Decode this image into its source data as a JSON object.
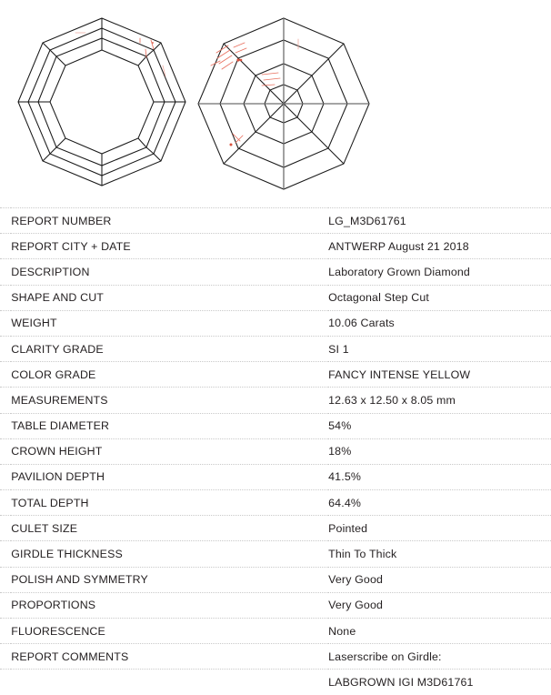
{
  "document": {
    "type": "laboratory-grown-diamond-report",
    "title": "Diamond Grading Report"
  },
  "diagrams": {
    "crown": {
      "name": "crown-view",
      "caption": "",
      "shape": "octagonal step cut crown",
      "ring_count": 4
    },
    "pavilion": {
      "name": "pavilion-view",
      "caption": "",
      "shape": "octagonal step cut pavilion",
      "ring_count": 4,
      "has_culet": true
    },
    "inclusion_color": "#d9503c",
    "facet_color": "#1a1a1a",
    "axis_color": "#6f6f6f"
  },
  "table": {
    "rows": [
      {
        "label": "REPORT NUMBER",
        "value": "LG_M3D61761"
      },
      {
        "label": "REPORT CITY + DATE",
        "value": "ANTWERP August 21 2018"
      },
      {
        "label": "DESCRIPTION",
        "value": "Laboratory Grown Diamond"
      },
      {
        "label": "SHAPE AND CUT",
        "value": "Octagonal Step Cut"
      },
      {
        "label": "WEIGHT",
        "value": "10.06 Carats"
      },
      {
        "label": "CLARITY GRADE",
        "value": "SI 1"
      },
      {
        "label": "COLOR GRADE",
        "value": "FANCY INTENSE YELLOW"
      },
      {
        "label": "MEASUREMENTS",
        "value": "12.63 x 12.50 x 8.05 mm"
      },
      {
        "label": "TABLE DIAMETER",
        "value": "54%"
      },
      {
        "label": "CROWN HEIGHT",
        "value": "18%"
      },
      {
        "label": "PAVILION DEPTH",
        "value": "41.5%"
      },
      {
        "label": "TOTAL DEPTH",
        "value": "64.4%"
      },
      {
        "label": "CULET SIZE",
        "value": "Pointed"
      },
      {
        "label": "GIRDLE THICKNESS",
        "value": "Thin To Thick"
      },
      {
        "label": "POLISH AND SYMMETRY",
        "value": "Very Good"
      },
      {
        "label": "PROPORTIONS",
        "value": "Very Good"
      },
      {
        "label": "FLUORESCENCE",
        "value": "None"
      },
      {
        "label": "REPORT COMMENTS",
        "value": "Laserscribe on Girdle:"
      },
      {
        "label": "",
        "value": "LABGROWN IGI M3D61761"
      }
    ]
  }
}
